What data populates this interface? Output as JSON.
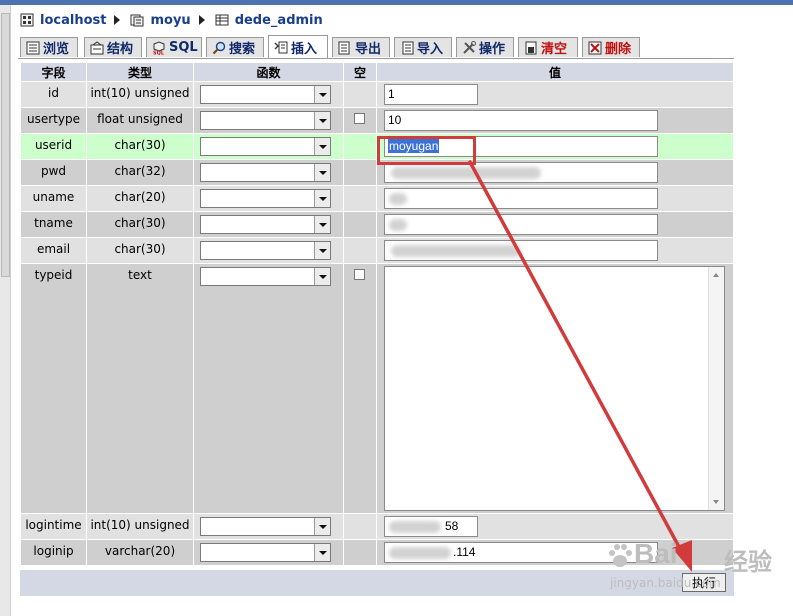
{
  "breadcrumb": {
    "server": "localhost",
    "database": "moyu",
    "table": "dede_admin"
  },
  "tabs": [
    {
      "label": "浏览",
      "icon": "browse-icon"
    },
    {
      "label": "结构",
      "icon": "structure-icon"
    },
    {
      "label": "SQL",
      "icon": "sql-icon"
    },
    {
      "label": "搜索",
      "icon": "search-icon"
    },
    {
      "label": "插入",
      "icon": "insert-icon",
      "active": true
    },
    {
      "label": "导出",
      "icon": "export-icon"
    },
    {
      "label": "导入",
      "icon": "import-icon"
    },
    {
      "label": "操作",
      "icon": "operations-icon"
    },
    {
      "label": "清空",
      "icon": "empty-icon",
      "warn": true
    },
    {
      "label": "删除",
      "icon": "drop-icon",
      "warn": true
    }
  ],
  "table": {
    "headers": {
      "field": "字段",
      "type": "类型",
      "function": "函数",
      "null": "空",
      "value": "值"
    },
    "rows": [
      {
        "field": "id",
        "type": "int(10) unsigned",
        "value": "1",
        "null_checkbox": false
      },
      {
        "field": "usertype",
        "type": "float unsigned",
        "value": "10",
        "null_checkbox": true
      },
      {
        "field": "userid",
        "type": "char(30)",
        "value": "moyugan",
        "null_checkbox": false,
        "highlighted": true
      },
      {
        "field": "pwd",
        "type": "char(32)",
        "value": "",
        "null_checkbox": false,
        "obscured": true
      },
      {
        "field": "uname",
        "type": "char(20)",
        "value": "",
        "null_checkbox": false,
        "obscured": true
      },
      {
        "field": "tname",
        "type": "char(30)",
        "value": "",
        "null_checkbox": false,
        "obscured": true
      },
      {
        "field": "email",
        "type": "char(30)",
        "value": "",
        "null_checkbox": false,
        "obscured": true
      },
      {
        "field": "typeid",
        "type": "text",
        "value": "",
        "null_checkbox": true,
        "textarea": true
      },
      {
        "field": "logintime",
        "type": "int(10) unsigned",
        "value": "58",
        "null_checkbox": false,
        "obscured": true
      },
      {
        "field": "loginip",
        "type": "varchar(20)",
        "value": ".114",
        "null_checkbox": false,
        "obscured": true
      }
    ]
  },
  "footer": {
    "execute_label": "执行"
  },
  "watermark": {
    "brand": "Bai",
    "brand_cn": "经验",
    "url": "jingyan.baidu.com"
  },
  "colors": {
    "header_bg": "#d4d8e4",
    "highlight_row": "#ccffcc",
    "annotation_red": "#d23b3b",
    "link_blue": "#1a3f8a"
  }
}
